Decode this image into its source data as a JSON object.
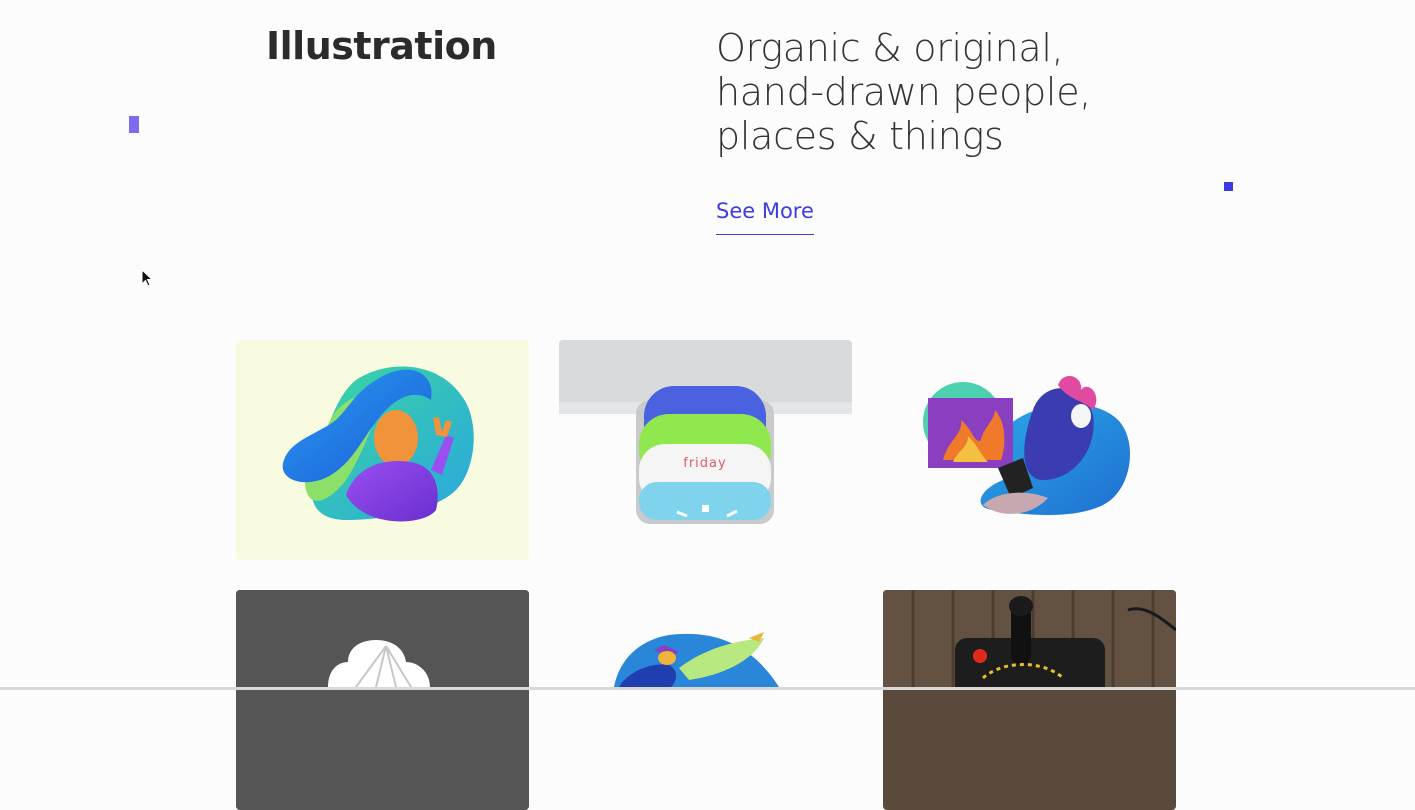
{
  "section": {
    "title": "Illustration"
  },
  "headline": {
    "lines": [
      "Organic & original,",
      "hand-drawn people,",
      "places & things"
    ]
  },
  "cta": {
    "label": "See More"
  },
  "gallery": {
    "items": [
      {
        "name": "peace-sign-person-illustration",
        "bg": "#f9fbe0"
      },
      {
        "name": "calendar-friday-illustration",
        "text": "friday"
      },
      {
        "name": "fire-laptop-person-illustration"
      },
      {
        "name": "cloud-illustration",
        "bg": "#555555"
      },
      {
        "name": "bird-illustration"
      },
      {
        "name": "joystick-photo"
      }
    ]
  },
  "colors": {
    "accent": "#3d3de0",
    "deco_purple": "#7b6cf0",
    "deco_blue": "#3b3be6"
  }
}
